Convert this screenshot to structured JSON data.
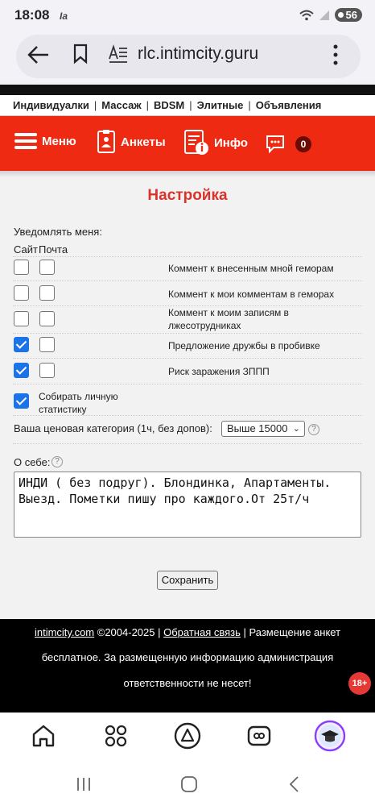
{
  "status": {
    "time": "18:08",
    "carrier_note": "Ia",
    "battery": "56"
  },
  "browser": {
    "url": "rlc.intimcity.guru"
  },
  "categories": [
    "Индивидуалки",
    "Массаж",
    "BDSM",
    "Элитные",
    "Объявления"
  ],
  "menu": {
    "menu_label": "Меню",
    "profiles_label": "Анкеты",
    "info_label": "Инфо",
    "messages_count": "0"
  },
  "page": {
    "title": "Настройка",
    "notify_label": "Уведомлять меня:",
    "col_site": "Сайт",
    "col_mail": "Почта",
    "options": [
      {
        "label": "Коммент к внесенным мной геморам",
        "site": false,
        "mail": false
      },
      {
        "label": "Коммент к мои комментам в геморах",
        "site": false,
        "mail": false
      },
      {
        "label": "Коммент к моим записям в лжесотрудниках",
        "site": false,
        "mail": false
      },
      {
        "label": "Предложение дружбы в пробивке",
        "site": true,
        "mail": false
      },
      {
        "label": "Риск заражения ЗППП",
        "site": true,
        "mail": false
      }
    ],
    "stats_label": "Собирать личную статистику",
    "stats_checked": true,
    "price_label": "Ваша ценовая категория (1ч, без допов):",
    "price_value": "Выше 15000",
    "about_label": "О себе:",
    "about_text": "ИНДИ ( без подруг). Блондинка, Апартаменты. Выезд. Пометки пишу про каждого.От 25т/ч",
    "save_label": "Сохранить"
  },
  "footer": {
    "site_link": "intimcity.com",
    "copyright": "©2004-2025 |",
    "feedback_link": "Обратная связь",
    "line1_rest": "| Размещение анкет",
    "line2": "бесплатное. За размещенную информацию администрация",
    "line3": "ответственности не несет!",
    "age_badge": "18+"
  },
  "colors": {
    "accent_red": "#ee2b12",
    "title_red": "#d9342b",
    "checkbox_blue": "#1a73e8"
  }
}
